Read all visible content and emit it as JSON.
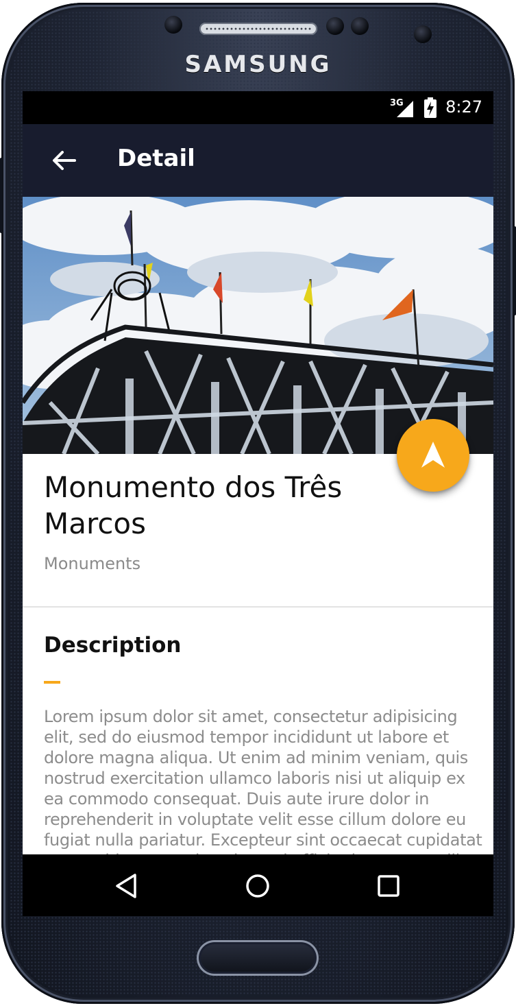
{
  "device": {
    "brand": "SAMSUNG"
  },
  "status_bar": {
    "network": "3G",
    "time": "8:27"
  },
  "app_bar": {
    "title": "Detail",
    "back_icon": "arrow-back-icon"
  },
  "detail": {
    "title": "Monumento dos Três Marcos",
    "category": "Monuments",
    "fab_icon": "navigation-arrow-icon",
    "section_title": "Description",
    "description": "Lorem ipsum dolor sit amet, consectetur adipisicing elit, sed do eiusmod tempor incididunt ut labore et dolore magna aliqua. Ut enim ad minim veniam, quis nostrud exercitation ullamco laboris nisi ut aliquip ex ea commodo consequat. Duis aute irure dolor in reprehenderit in voluptate velit esse cillum dolore eu fugiat nulla pariatur. Excepteur sint occaecat cupidatat non proident, sunt in culpa qui officia deserunt mollit anim id est laborum."
  },
  "nav_bar": {
    "back": "nav-back-icon",
    "home": "nav-home-icon",
    "recents": "nav-recents-icon"
  },
  "colors": {
    "app_bar": "#181c2e",
    "accent": "#f7a81b",
    "secondary_text": "#8c8c8c"
  }
}
